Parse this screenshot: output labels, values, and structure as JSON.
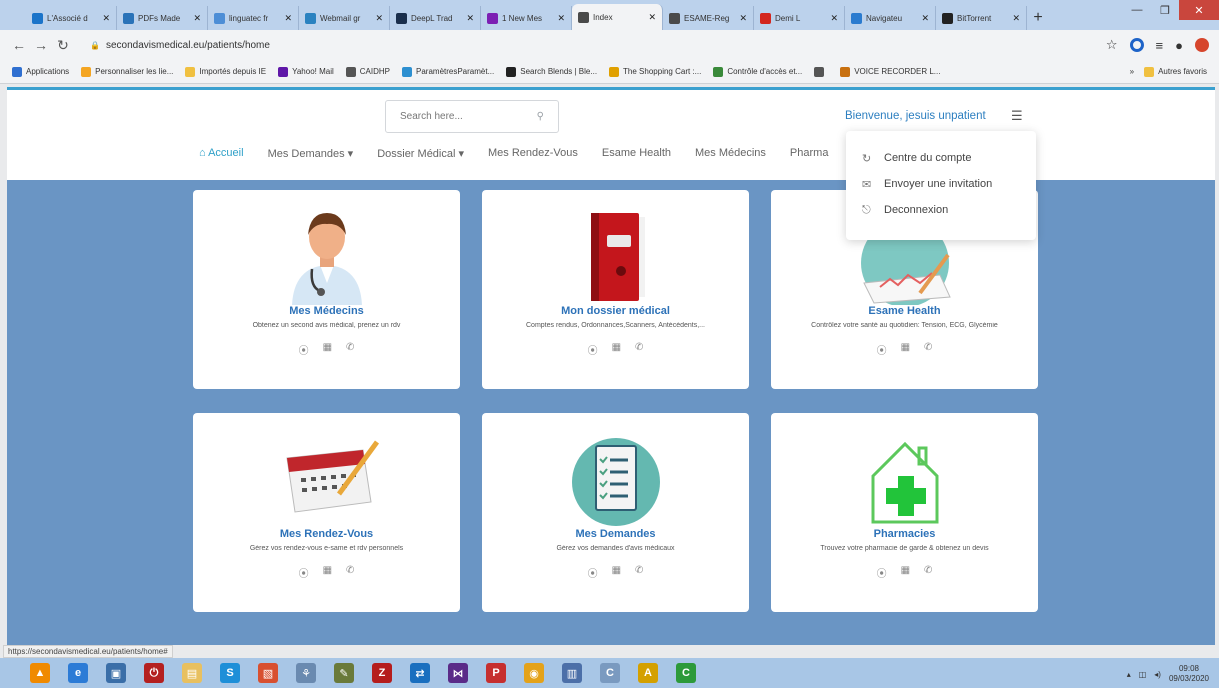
{
  "browser": {
    "tabs": [
      {
        "title": "L'Associé d",
        "color": "#1b74c9"
      },
      {
        "title": "PDFs Made",
        "color": "#2a73b8"
      },
      {
        "title": "linguatec fr",
        "color": "#4d8ed6"
      },
      {
        "title": "Webmail gr",
        "color": "#2a82c0"
      },
      {
        "title": "DeepL Trad",
        "color": "#1a2f4c"
      },
      {
        "title": "1 New Mes",
        "color": "#7c1fb3"
      },
      {
        "title": "Index",
        "color": "#4a4a4a"
      },
      {
        "title": "ESAME-Reg",
        "color": "#4a4a4a"
      },
      {
        "title": "Demi L",
        "color": "#d3261e"
      },
      {
        "title": "Navigateu",
        "color": "#2a7bcf"
      },
      {
        "title": "BitTorrent",
        "color": "#222222"
      }
    ],
    "active_tab_index": 6,
    "url": "secondavismedical.eu/patients/home",
    "bookmarks": [
      {
        "label": "Applications",
        "color": "#2f6fd0"
      },
      {
        "label": "Personnaliser les lie...",
        "color": "#f4a522"
      },
      {
        "label": "Importés depuis IE",
        "color": "#f0c040"
      },
      {
        "label": "Yahoo! Mail",
        "color": "#5f17a8"
      },
      {
        "label": "CAIDHP",
        "color": "#555555"
      },
      {
        "label": "ParamètresParamèt...",
        "color": "#2d8fd0"
      },
      {
        "label": "Search Blends | Ble...",
        "color": "#222222"
      },
      {
        "label": "The Shopping Cart :...",
        "color": "#e0a000"
      },
      {
        "label": "Contrôle d'accès et...",
        "color": "#3a8a3a"
      },
      {
        "label": "",
        "color": "#555555"
      },
      {
        "label": "VOICE RECORDER L...",
        "color": "#c87010"
      }
    ],
    "bookmarks_more": "»",
    "other_bookmarks": "Autres favoris"
  },
  "site": {
    "search_placeholder": "Search here...",
    "welcome": "Bienvenue, jesuis unpatient",
    "nav": [
      "Accueil",
      "Mes Demandes",
      "Dossier Médical",
      "Mes Rendez-Vous",
      "Esame Health",
      "Mes Médecins",
      "Pharma"
    ],
    "dropdown": [
      "Centre du compte",
      "Envoyer une invitation",
      "Deconnexion"
    ],
    "cards": [
      {
        "title": "Mes Médecins",
        "desc": "Obtenez un second avis médical, prenez un rdv"
      },
      {
        "title": "Mon dossier médical",
        "desc": "Comptes rendus, Ordonnances,Scanners, Antécédents,..."
      },
      {
        "title": "Esame Health",
        "desc": "Contrôlez votre santé au quotidien: Tension, ECG, Glycémie"
      },
      {
        "title": "Mes Rendez-Vous",
        "desc": "Gérez vos rendez-vous e-same et rdv personnels"
      },
      {
        "title": "Mes Demandes",
        "desc": "Gérez vos demandes d'avis médicaux"
      },
      {
        "title": "Pharmacies",
        "desc": "Trouvez votre pharmacie de garde & obtenez un devis"
      }
    ],
    "accent": "#3ba0cf",
    "background": "#6a95c4",
    "title_color": "#2d72b8"
  },
  "status_url": "https://secondavismedical.eu/patients/home#",
  "taskbar": {
    "clock_time": "09:08",
    "clock_date": "09/03/2020"
  }
}
